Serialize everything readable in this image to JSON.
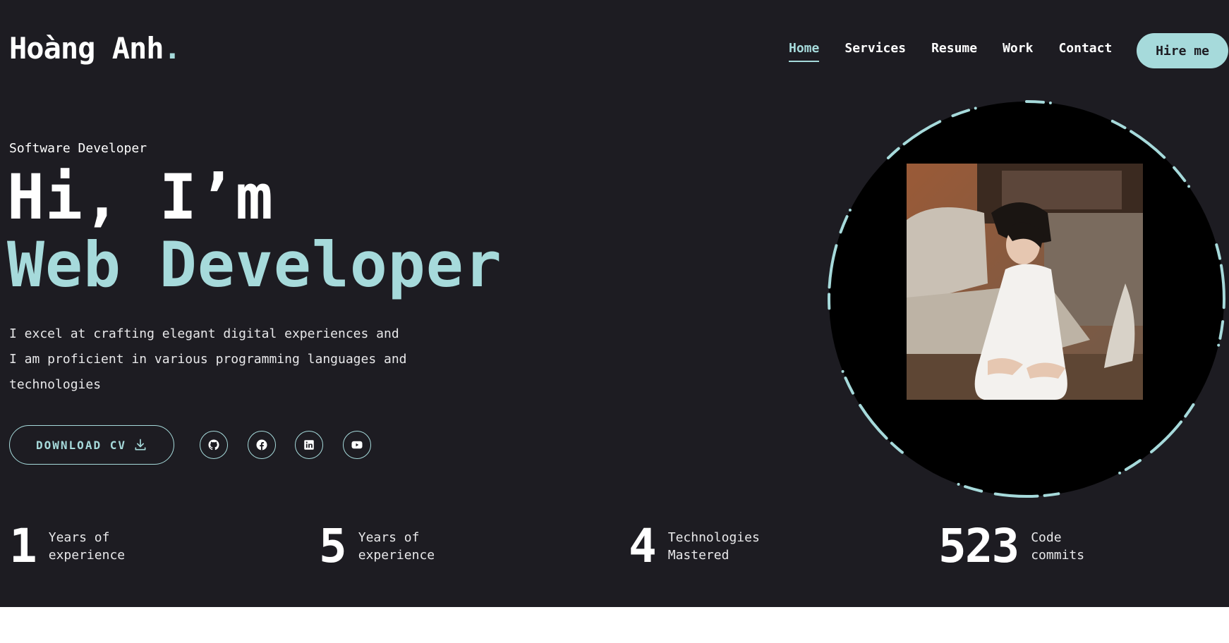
{
  "brand": {
    "name": "Hoàng Anh",
    "dot": "."
  },
  "nav": {
    "items": [
      {
        "label": "Home",
        "active": true
      },
      {
        "label": "Services",
        "active": false
      },
      {
        "label": "Resume",
        "active": false
      },
      {
        "label": "Work",
        "active": false
      },
      {
        "label": "Contact",
        "active": false
      }
    ],
    "hire_label": "Hire me"
  },
  "hero": {
    "subtitle": "Software Developer",
    "greeting": "Hi, I’m",
    "role": "Web Developer",
    "description_lines": [
      "I excel at crafting elegant digital experiences and",
      "I am proficient in various programming languages and",
      "technologies"
    ],
    "cv_label": "DOWNLOAD CV",
    "socials": [
      "github-icon",
      "facebook-icon",
      "linkedin-icon",
      "youtube-icon"
    ]
  },
  "stats": [
    {
      "value": "1",
      "label_lines": [
        "Years of",
        "experience"
      ]
    },
    {
      "value": "5",
      "label_lines": [
        "Years of",
        "experience"
      ]
    },
    {
      "value": "4",
      "label_lines": [
        "Technologies",
        "Mastered"
      ]
    },
    {
      "value": "523",
      "label_lines": [
        "Code",
        "commits"
      ]
    }
  ],
  "colors": {
    "background": "#1d1c22",
    "accent": "#a6dadb",
    "text": "#ffffff"
  }
}
